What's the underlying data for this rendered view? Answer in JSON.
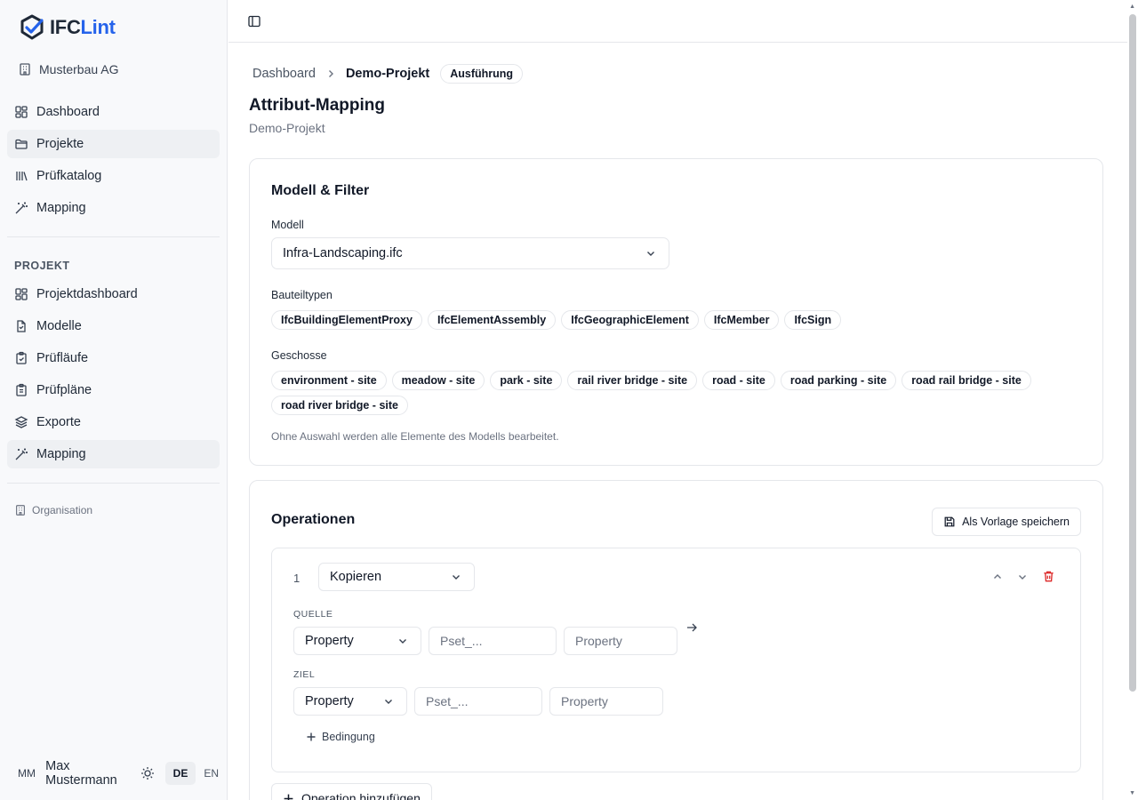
{
  "app": {
    "logo_ifc": "IFC",
    "logo_lint": "Lint"
  },
  "sidebar": {
    "org_name": "Musterbau AG",
    "main_items": [
      {
        "label": "Dashboard",
        "icon": "dashboard-icon"
      },
      {
        "label": "Projekte",
        "icon": "folder-icon",
        "active": true
      },
      {
        "label": "Prüfkatalog",
        "icon": "library-icon"
      },
      {
        "label": "Mapping",
        "icon": "wand-icon"
      }
    ],
    "section_label": "PROJEKT",
    "project_items": [
      {
        "label": "Projektdashboard",
        "icon": "dashboard-icon"
      },
      {
        "label": "Modelle",
        "icon": "file-icon"
      },
      {
        "label": "Prüfläufe",
        "icon": "clipboard-check-icon"
      },
      {
        "label": "Prüfpläne",
        "icon": "clipboard-list-icon"
      },
      {
        "label": "Exporte",
        "icon": "layers-icon"
      },
      {
        "label": "Mapping",
        "icon": "wand-icon",
        "active": true
      }
    ],
    "org_link": "Organisation",
    "user": {
      "initials": "MM",
      "name": "Max Mustermann"
    },
    "lang": {
      "de": "DE",
      "en": "EN",
      "active": "DE"
    }
  },
  "breadcrumb": {
    "root": "Dashboard",
    "current": "Demo-Projekt",
    "badge": "Ausführung"
  },
  "page": {
    "title": "Attribut-Mapping",
    "subtitle": "Demo-Projekt"
  },
  "filter": {
    "title": "Modell & Filter",
    "model_label": "Modell",
    "model_value": "Infra-Landscaping.ifc",
    "types_label": "Bauteiltypen",
    "types": [
      "IfcBuildingElementProxy",
      "IfcElementAssembly",
      "IfcGeographicElement",
      "IfcMember",
      "IfcSign"
    ],
    "storeys_label": "Geschosse",
    "storeys": [
      "environment - site",
      "meadow - site",
      "park - site",
      "rail river bridge - site",
      "road - site",
      "road parking - site",
      "road rail bridge - site",
      "road river bridge - site"
    ],
    "hint": "Ohne Auswahl werden alle Elemente des Modells bearbeitet."
  },
  "operations": {
    "title": "Operationen",
    "save_template": "Als Vorlage speichern",
    "items": [
      {
        "number": "1",
        "type": "Kopieren",
        "source_label": "QUELLE",
        "source_kind": "Property",
        "source_pset_placeholder": "Pset_...",
        "source_prop_placeholder": "Property",
        "target_label": "ZIEL",
        "target_kind": "Property",
        "target_pset_placeholder": "Pset_...",
        "target_prop_placeholder": "Property",
        "add_condition": "Bedingung"
      }
    ],
    "add_operation": "Operation hinzufügen"
  },
  "colors": {
    "accent": "#2563eb",
    "delete": "#dc2626",
    "border": "#e5e7eb"
  }
}
